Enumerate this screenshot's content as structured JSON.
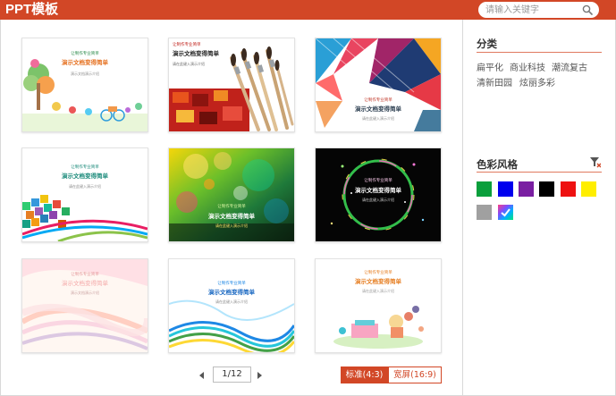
{
  "header": {
    "title": "PPT模板",
    "search_placeholder": "请输入关键字"
  },
  "templates": [
    {
      "name": "cartoon-kids",
      "line1": "让制作专业简单",
      "line2": "演示文档变得简单",
      "line3": "演示文档演示介绍"
    },
    {
      "name": "paintbrushes",
      "line1": "让制作专业简单",
      "line2": "演示文档变得简单",
      "line3": "请在此键入演示介绍"
    },
    {
      "name": "geometric-triangles",
      "line1": "让制作专业简单",
      "line2": "演示文档变得简单",
      "line3": "请在此键入演示介绍"
    },
    {
      "name": "colorful-squares",
      "line1": "让制作专业简单",
      "line2": "演示文档变得简单",
      "line3": "请在此键入演示介绍"
    },
    {
      "name": "bokeh-lights",
      "line1": "让制作专业简单",
      "line2": "演示文档变得简单",
      "line3": "请在此键入演示介绍"
    },
    {
      "name": "neon-ring",
      "line1": "让制作专业简单",
      "line2": "演示文档变得简单",
      "line3": "请在此键入演示介绍"
    },
    {
      "name": "pastel-waves",
      "line1": "让制作专业简单",
      "line2": "演示文档变得简单",
      "line3": "演示文档演示介绍"
    },
    {
      "name": "blue-waves",
      "line1": "让制作专业简单",
      "line2": "演示文档变得简单",
      "line3": "请在此键入演示介绍"
    },
    {
      "name": "cartoon-reading",
      "line1": "让制作专业简单",
      "line2": "演示文档变得简单",
      "line3": "请在此键入演示介绍"
    }
  ],
  "pager": {
    "page": "1/12"
  },
  "ratios": {
    "standard": "标准(4:3)",
    "wide": "宽屏(16:9)"
  },
  "sidebar": {
    "category_title": "分类",
    "categories": [
      "扁平化",
      "商业科技",
      "潮流复古",
      "清新田园",
      "炫丽多彩"
    ],
    "color_title": "色彩风格",
    "colors": [
      "#0a9f3c",
      "#0000ee",
      "#7a1fa2",
      "#000000",
      "#ee1111",
      "#ffee00",
      "#a0a0a0",
      "multicolor"
    ]
  }
}
